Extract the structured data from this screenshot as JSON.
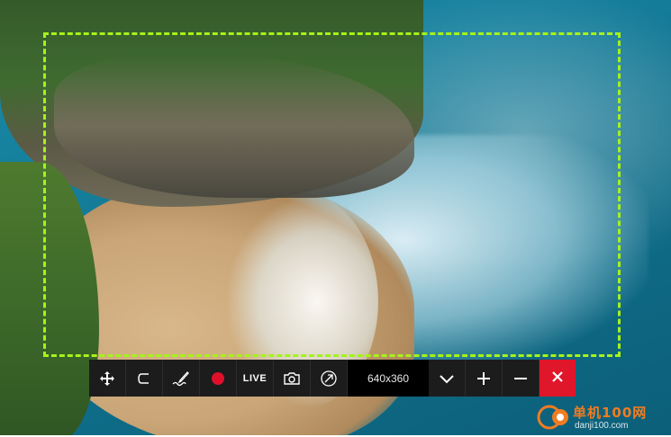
{
  "toolbar": {
    "live_label": "LIVE",
    "size_label": "640x360",
    "buttons": [
      "move-icon",
      "lasso-icon",
      "pen-icon",
      "record-icon",
      "live-button",
      "camera-icon",
      "link-icon",
      "size-display",
      "chevron-down-icon",
      "plus-icon",
      "minus-icon",
      "close-icon"
    ],
    "record_color": "#e0102b",
    "close_bg_color": "#e0162b"
  },
  "selection": {
    "border_color": "#a6f21a"
  },
  "watermark": {
    "text": "单机100网",
    "url": "danji100.com"
  }
}
